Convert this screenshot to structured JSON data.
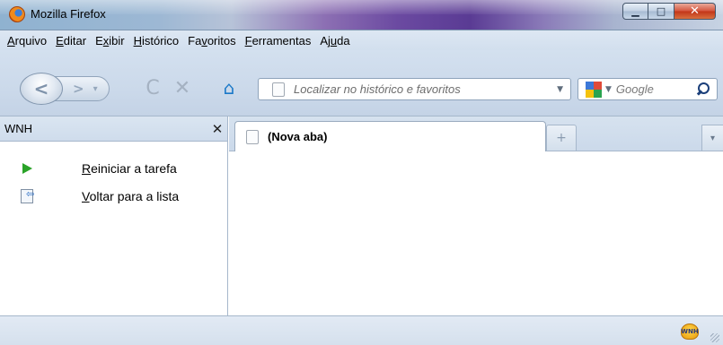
{
  "window": {
    "title": "Mozilla Firefox",
    "min_glyph": "▁",
    "max_glyph": "□",
    "close_glyph": "✕"
  },
  "menu": [
    {
      "accel": "A",
      "rest": "rquivo"
    },
    {
      "accel": "E",
      "rest": "ditar"
    },
    {
      "pre": "E",
      "accel": "x",
      "rest": "ibir"
    },
    {
      "accel": "H",
      "rest": "istórico"
    },
    {
      "pre": "Fa",
      "accel": "v",
      "rest": "oritos"
    },
    {
      "accel": "F",
      "rest": "erramentas"
    },
    {
      "pre": "Aj",
      "accel": "u",
      "rest": "da"
    }
  ],
  "toolbar": {
    "back_glyph": "<",
    "forward_glyph": ">",
    "reload_glyph": "C",
    "stop_glyph": "✕",
    "home_glyph": "⌂",
    "url_placeholder": "Localizar no histórico e favoritos",
    "search_placeholder": "Google"
  },
  "sidebar": {
    "title": "WNH",
    "close_glyph": "✕",
    "items": [
      {
        "accel": "R",
        "rest": "einiciar a tarefa"
      },
      {
        "accel": "V",
        "rest": "oltar para a lista"
      }
    ]
  },
  "tabs": [
    {
      "label": "(Nova aba)"
    }
  ],
  "newtab_glyph": "+",
  "alltabs_glyph": "▾",
  "statusbar": {
    "badge_text": "WNH"
  },
  "colors": {
    "google_blue": "#3c78d8",
    "google_red": "#e04a3a",
    "google_yellow": "#f4c20d",
    "google_green": "#2aa34f",
    "play_green": "#2aa328",
    "home_blue": "#1a78c8"
  }
}
